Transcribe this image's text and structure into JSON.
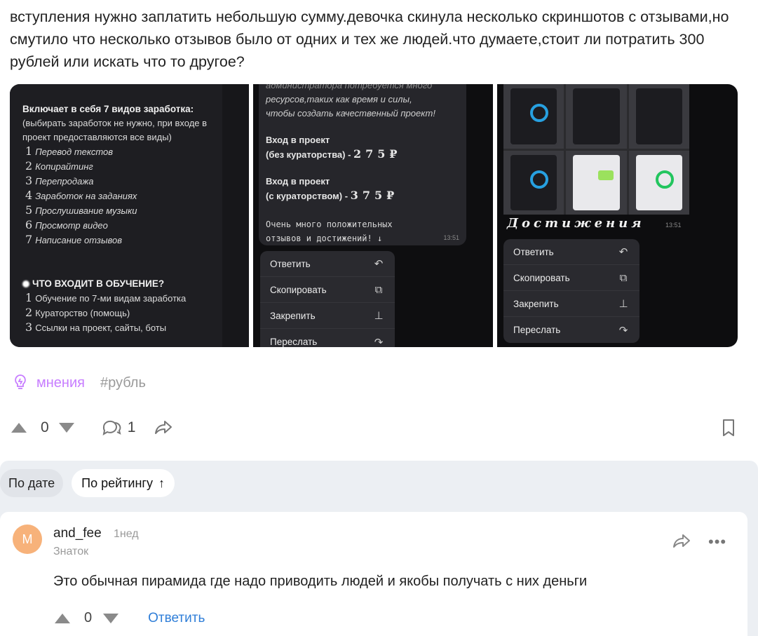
{
  "post": {
    "text": "вступления нужно заплатить небольшую сумму.девочка скинула несколько скриншотов с отзывами,но смутило что несколько отзывов было от одних и тех же людей.что думаете,стоит ли потратить 300 рублей или искать что то другое?"
  },
  "gallery": {
    "shot1": {
      "heading": "Включает в себя 7 видов заработка:",
      "subheading": "(выбирать заработок не нужно, при входе в проект предоставляются все виды)",
      "items": [
        {
          "num": "1",
          "text": "Перевод текстов"
        },
        {
          "num": "2",
          "text": "Копирайтинг"
        },
        {
          "num": "3",
          "text": "Перепродажа"
        },
        {
          "num": "4",
          "text": "Заработок на заданиях"
        },
        {
          "num": "5",
          "text": "Прослушивание музыки"
        },
        {
          "num": "6",
          "text": "Просмотр видео"
        },
        {
          "num": "7",
          "text": "Написание отзывов"
        }
      ],
      "section_title": "ЧТО ВХОДИТ В ОБУЧЕНИЕ?",
      "section_items": [
        {
          "num": "1",
          "text": "Обучение по 7-ми видам заработка"
        },
        {
          "num": "2",
          "text": "Кураторство (помощь)"
        },
        {
          "num": "3",
          "text": "Ссылки на проект, сайты, боты"
        }
      ]
    },
    "shot2": {
      "top_line1": "администратора потребуется много",
      "top_line2": "ресурсов,таких как время и силы,",
      "top_line3": "чтобы создать качественный проект!",
      "entry1_line1": "Вход в проект",
      "entry1_line2": "(без кураторства) -",
      "entry1_price": "275₽",
      "entry2_line1": "Вход в проект",
      "entry2_line2": "(с кураторством) -",
      "entry2_price": "375₽",
      "mono_line1": "Очень много положительных",
      "mono_line2": "отзывов и достижений! ↓",
      "time": "13:51",
      "menu": [
        "Ответить",
        "Скопировать",
        "Закрепить",
        "Переслать"
      ]
    },
    "shot3": {
      "title": "Достижения",
      "time": "13:51",
      "menu": [
        "Ответить",
        "Скопировать",
        "Закрепить",
        "Переслать"
      ]
    }
  },
  "tags": {
    "primary": "мнения",
    "secondary": "#рубль"
  },
  "actions": {
    "votes": "0",
    "comments": "1"
  },
  "sort": {
    "by_date": "По дате",
    "by_rating": "По рейтингу",
    "arrow": "↑"
  },
  "comment": {
    "avatar_letter": "M",
    "username": "and_fee",
    "time": "1нед",
    "rank": "Знаток",
    "text": "Это обычная пирамида где надо приводить людей и якобы получать с них деньги",
    "votes": "0",
    "reply": "Ответить",
    "more": "•••"
  },
  "colors": {
    "tag_primary": "#c77dff",
    "link": "#2f7ed8",
    "avatar_bg": "#f7b27a",
    "comments_bg": "#eceff3"
  }
}
